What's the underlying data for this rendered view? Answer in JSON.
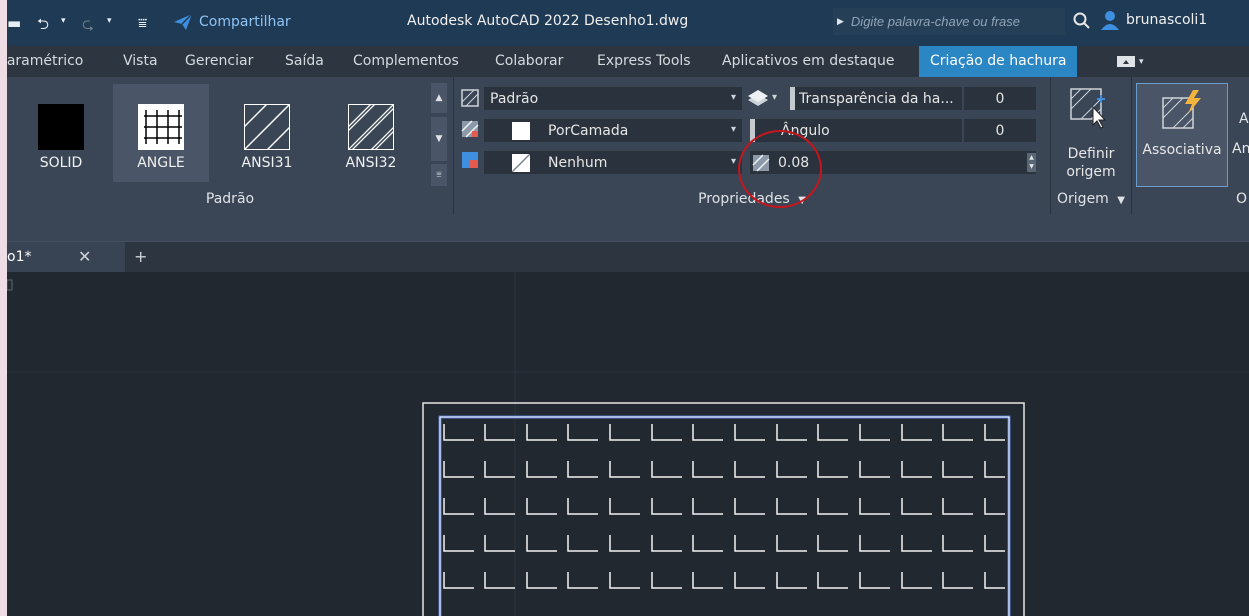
{
  "title_bar": {
    "share_label": "Compartilhar",
    "app_title": "Autodesk AutoCAD 2022   Desenho1.dwg",
    "search_placeholder": "Digite palavra-chave ou frase",
    "user_name": "brunascoli1"
  },
  "ribbon_tabs": [
    {
      "label": "Paramétrico"
    },
    {
      "label": "Vista"
    },
    {
      "label": "Gerenciar"
    },
    {
      "label": "Saída"
    },
    {
      "label": "Complementos"
    },
    {
      "label": "Colaborar"
    },
    {
      "label": "Express Tools"
    },
    {
      "label": "Aplicativos em destaque"
    },
    {
      "label": "Criação de hachura",
      "active": true
    }
  ],
  "pattern_panel": {
    "title": "Padrão",
    "swatches": [
      {
        "label": "SOLID"
      },
      {
        "label": "ANGLE",
        "selected": true
      },
      {
        "label": "ANSI31"
      },
      {
        "label": "ANSI32"
      }
    ]
  },
  "properties_panel": {
    "title": "Propriedades",
    "hatch_type": "Padrão",
    "hatch_color": "PorCamada",
    "background_color": "Nenhum",
    "transparency_label": "Transparência da ha...",
    "transparency_value": "0",
    "angle_label": "Ângulo",
    "angle_value": "0",
    "scale_value": "0.08"
  },
  "origin_panel": {
    "title": "Origem",
    "set_origin_label_1": "Definir",
    "set_origin_label_2": "origem"
  },
  "options_panel": {
    "associative_label": "Associativa",
    "annotative_partial": "An",
    "title_partial": "O"
  },
  "document_tabs": {
    "active_label": "o1*"
  },
  "colors": {
    "accent": "#2b86c4",
    "title_bar": "#1f3a54",
    "ribbon": "#3a4656",
    "canvas": "#212830",
    "highlight_circle": "#c4161c",
    "selection_blue": "#5577cc"
  }
}
